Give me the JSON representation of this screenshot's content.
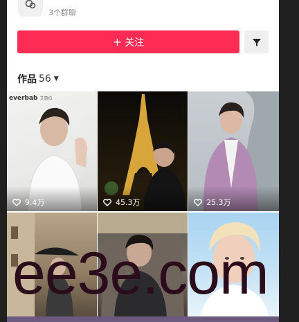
{
  "group": {
    "name": "...",
    "count_text": "3个群聊"
  },
  "follow_button": {
    "plus": "+",
    "label": "关注"
  },
  "works": {
    "label": "作品",
    "count": "56",
    "caret": "▼"
  },
  "tiles": [
    {
      "likes": "9.4万",
      "brand": "everbab",
      "brand_sub": "艾惠伯"
    },
    {
      "likes": "45.3万"
    },
    {
      "likes": "25.3万"
    },
    {
      "likes": ""
    },
    {
      "likes": ""
    },
    {
      "likes": ""
    }
  ],
  "watermark": "ee3e.com",
  "colors": {
    "accent": "#fe2c55",
    "panel": "#ffffff",
    "background": "#202020"
  },
  "icons": {
    "group": "group-chat-icon",
    "filter": "filter-icon",
    "like": "heart-icon"
  }
}
